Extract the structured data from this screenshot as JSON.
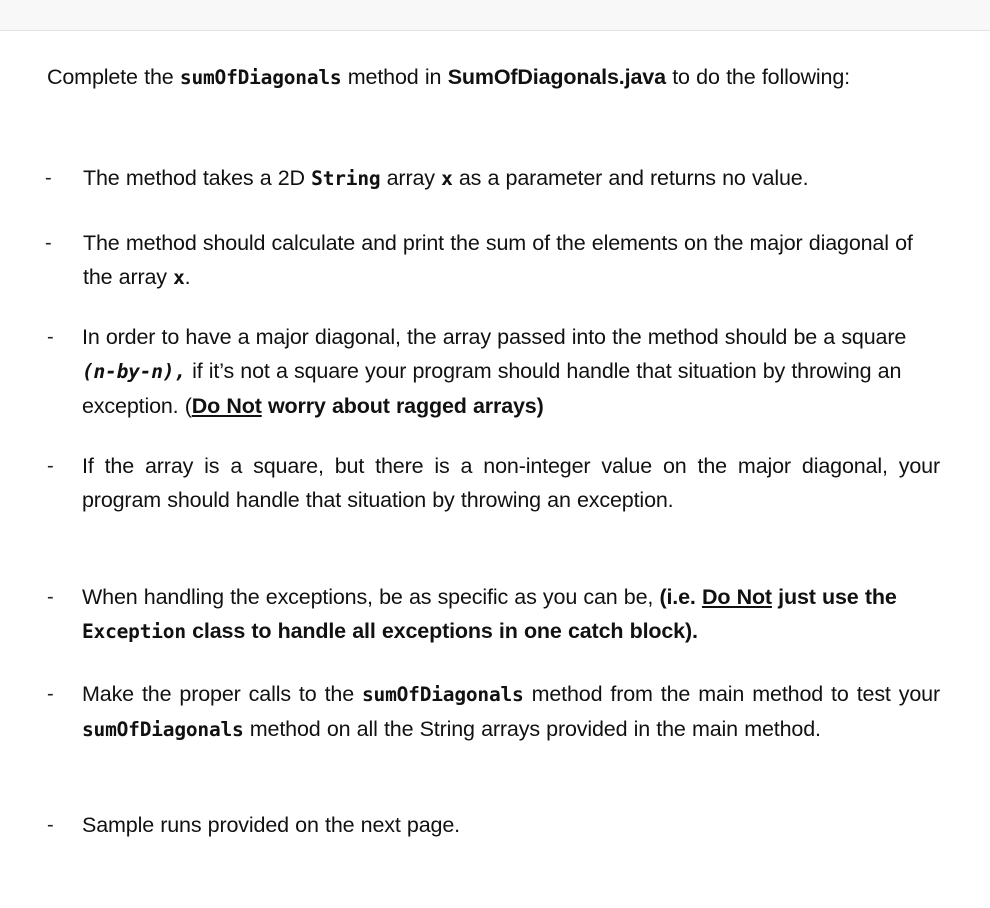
{
  "page": {
    "background_color": "#ffffff",
    "top_strip_color": "#f8f8f8",
    "top_strip_border_color": "#e3e3e5",
    "text_color": "#111111"
  },
  "intro": {
    "segment_1": "Complete the ",
    "method_name": "sumOfDiagonals",
    "segment_2": " method in ",
    "file_name": "SumOfDiagonals.java",
    "segment_3": " to do the following:"
  },
  "bullets": [
    {
      "marker": "-",
      "segment_1": "The method takes a 2D ",
      "code_1": "String",
      "segment_2": " array ",
      "code_2": "x",
      "segment_3": " as a parameter and returns no value.",
      "full_text": "The method takes a 2D String array x as a parameter and returns no value."
    },
    {
      "marker": "-",
      "segment_1": "The method should calculate and print the sum of the elements on the major diagonal of the array ",
      "code_1": "x",
      "segment_2": ".",
      "full_text": "The method should calculate and print the sum of the elements on the major diagonal of the array x."
    },
    {
      "marker": "-",
      "segment_1": "In order to have a major diagonal, the array passed into the method should be a square ",
      "code_1": "(n-by-n),",
      "segment_2": " if it’s not a square your program should handle that situation by throwing an exception. (",
      "emph_1": "Do Not",
      "segment_3": " ",
      "emph_2": "worry about ragged arrays",
      "segment_4": ")",
      "full_text": "In order to have a major diagonal, the array passed into the method should be a square (n-by-n), if it’s not a square your program should handle that situation by throwing an exception. (Do Not worry about ragged arrays)"
    },
    {
      "marker": "-",
      "segment_1": "If the array is a square, but there is a non-integer value on the major diagonal, your program should handle that situation by throwing an exception.",
      "full_text": "If the array is a square, but there is a non-integer value on the major diagonal, your program should handle that situation by throwing an exception."
    },
    {
      "marker": "-",
      "segment_1": "When handling the exceptions, be as specific as you can be, ",
      "emph_1": "(i.e. ",
      "emph_2": "Do Not",
      "emph_3": " just use the ",
      "code_1": "Exception",
      "emph_4": " class to handle all exceptions in one catch block).",
      "full_text": "When handling the exceptions, be as specific as you can be, (i.e. Do Not just use the Exception class to handle all exceptions in one catch block)."
    },
    {
      "marker": "-",
      "segment_1": "Make the proper calls to the ",
      "code_1": "sumOfDiagonals",
      "segment_2": " method from the main method to test your ",
      "code_2": "sumOfDiagonals",
      "segment_3": " method on all the String arrays provided in the main method.",
      "full_text": "Make the proper calls to the sumOfDiagonals method from the main method to test your sumOfDiagonals method on all the String arrays provided in the main method."
    },
    {
      "marker": "-",
      "segment_1": "Sample runs provided on the next page.",
      "full_text": "Sample runs provided on the next page."
    }
  ]
}
